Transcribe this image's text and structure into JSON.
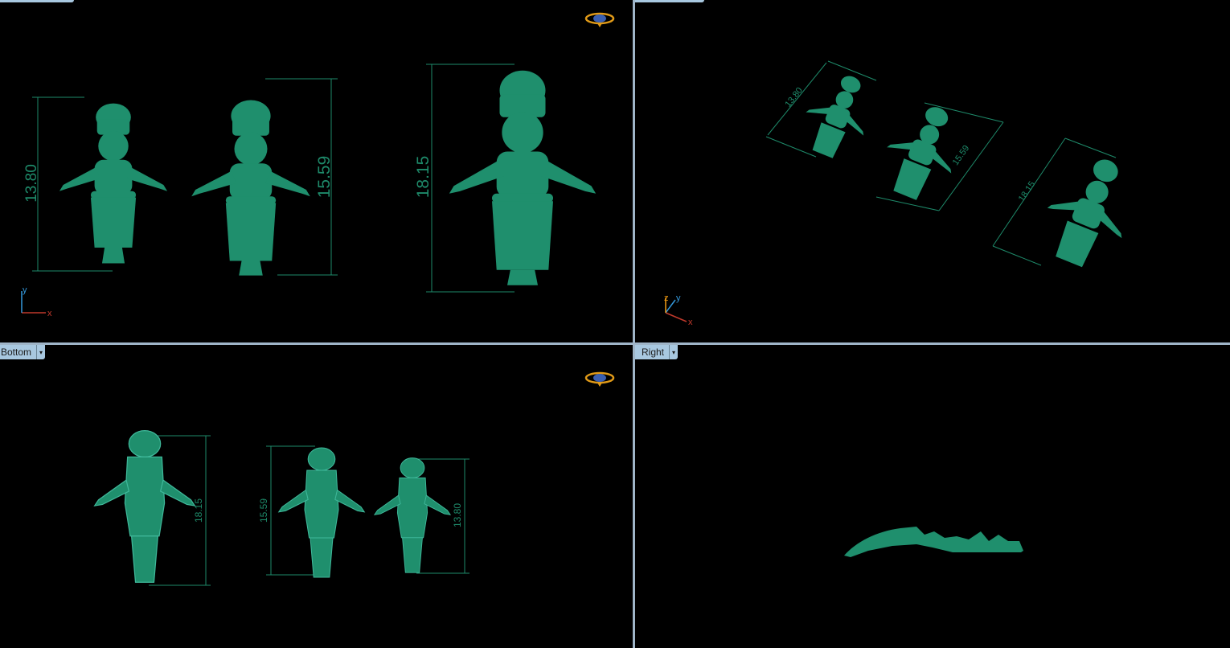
{
  "viewports": {
    "top_left": {
      "label": ""
    },
    "top_right": {
      "label": ""
    },
    "bottom_left": {
      "label": "Bottom"
    },
    "bottom_right": {
      "label": "Right"
    }
  },
  "dimensions": {
    "small": "13.80",
    "medium": "15.59",
    "large": "18.15"
  },
  "axes": {
    "x": "x",
    "y": "y",
    "z": "z"
  },
  "colors": {
    "model": "#1f8f6d",
    "dim_line": "#1e8a6a",
    "x_axis": "#c0392b",
    "y_axis": "#3498db",
    "z_axis": "#f39c12",
    "separator": "#9fb5c8"
  },
  "dropdown_glyph": "▾"
}
